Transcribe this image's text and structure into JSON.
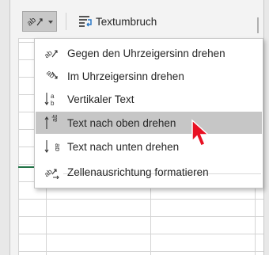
{
  "ribbon": {
    "orientation_button_icon": "text-orientation-icon",
    "wrap_text_label": "Textumbruch",
    "wrap_text_icon": "wrap-text-icon"
  },
  "menu": {
    "items": [
      {
        "label": "Gegen den Uhrzeigersinn drehen",
        "icon": "angle-counterclockwise-icon"
      },
      {
        "label": "Im Uhrzeigersinn drehen",
        "icon": "angle-clockwise-icon"
      },
      {
        "label": "Vertikaler Text",
        "icon": "vertical-text-icon"
      },
      {
        "label": "Text nach oben drehen",
        "icon": "rotate-text-up-icon",
        "highlighted": true
      },
      {
        "label": "Text nach unten drehen",
        "icon": "rotate-text-down-icon"
      },
      {
        "label": "Zellenausrichtung formatieren",
        "icon": "format-cell-alignment-icon"
      }
    ]
  },
  "colors": {
    "highlight": "#c6c6c6",
    "cursor": "#e81123",
    "grid_accent": "#217346"
  }
}
